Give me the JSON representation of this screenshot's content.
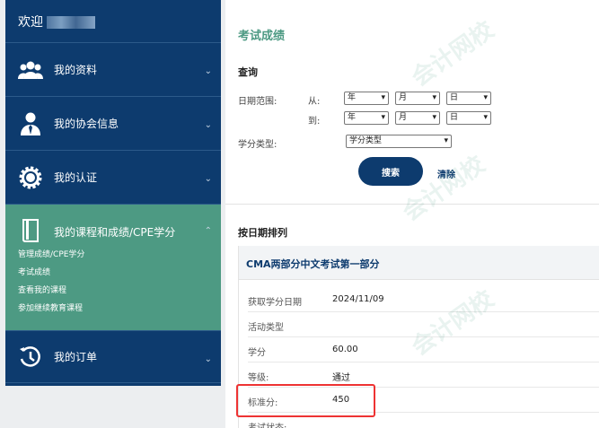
{
  "sidebar": {
    "welcome": "欢迎",
    "items": [
      {
        "label": "我的资料",
        "icon": "users-icon"
      },
      {
        "label": "我的协会信息",
        "icon": "user-tie-icon"
      },
      {
        "label": "我的认证",
        "icon": "gear-badge-icon"
      },
      {
        "label": "我的课程和成绩/CPE学分",
        "icon": "book-icon",
        "sub": [
          "管理成绩/CPE学分",
          "考试成绩",
          "查看我的课程",
          "参加继续教育课程"
        ]
      },
      {
        "label": "我的订单",
        "icon": "history-icon"
      }
    ]
  },
  "main": {
    "title": "考试成绩",
    "query_title": "查询",
    "date_range_label": "日期范围:",
    "from_label": "从:",
    "to_label": "到:",
    "year": "年",
    "month": "月",
    "day": "日",
    "credit_type_label": "学分类型:",
    "credit_type_value": "学分类型",
    "search_button": "搜索",
    "clear_link": "清除",
    "sort_title": "按日期排列",
    "record": {
      "title": "CMA两部分中文考试第一部分",
      "fields": [
        {
          "k": "获取学分日期",
          "v": "2024/11/09"
        },
        {
          "k": "活动类型",
          "v": ""
        },
        {
          "k": "学分",
          "v": "60.00"
        },
        {
          "k": "等级:",
          "v": "通过"
        },
        {
          "k": "标准分:",
          "v": "450"
        },
        {
          "k": "考试状态:",
          "v": ""
        }
      ]
    }
  },
  "watermark": "会计网校"
}
